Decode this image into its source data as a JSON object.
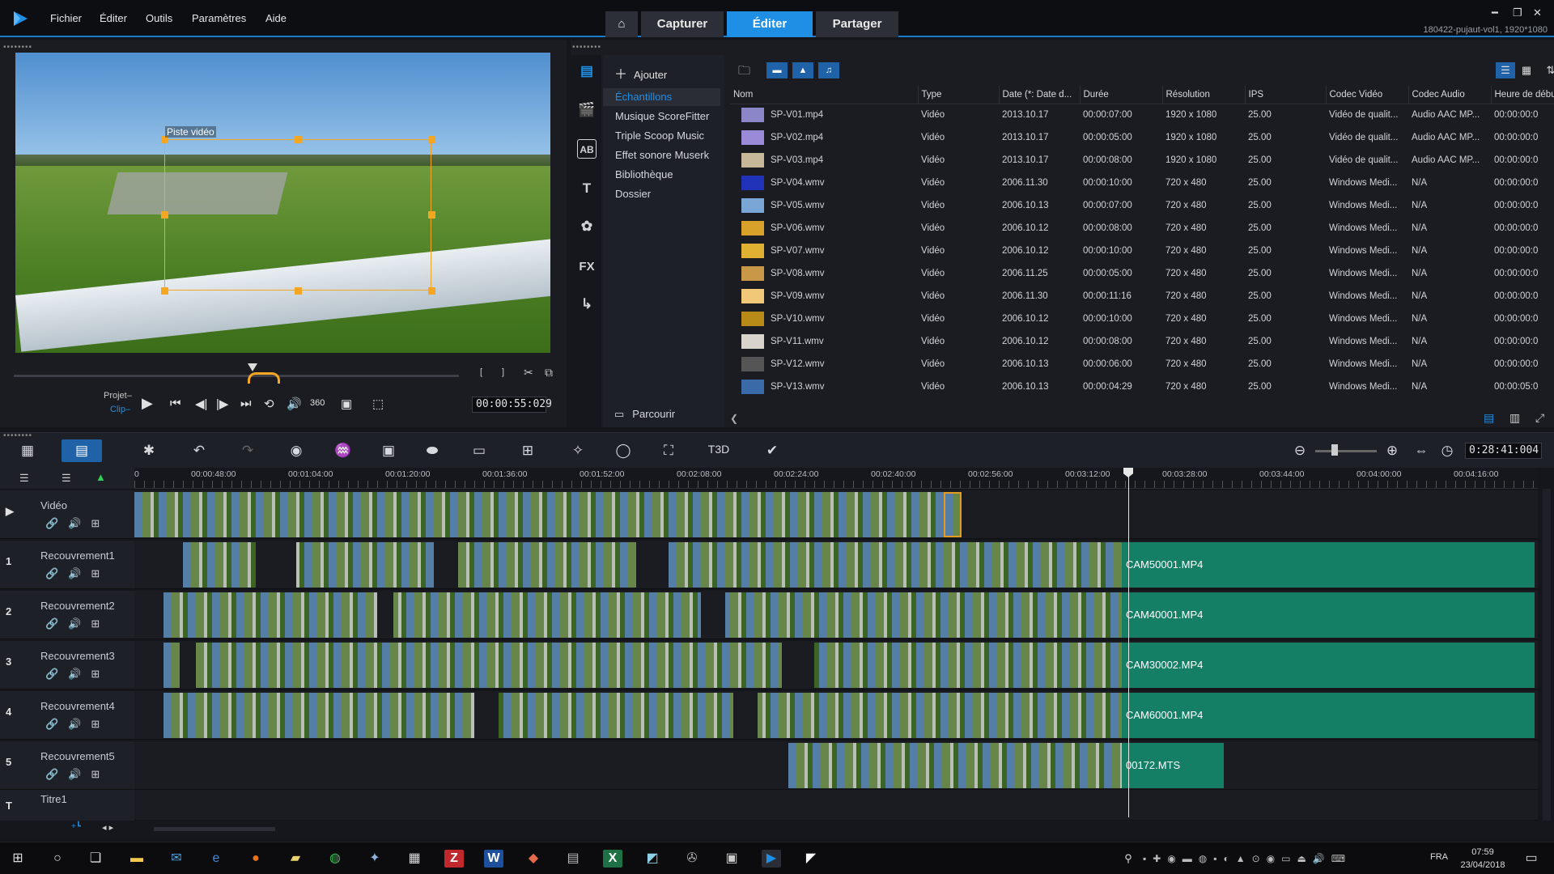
{
  "menubar": {
    "items": [
      "Fichier",
      "Éditer",
      "Outils",
      "Paramètres",
      "Aide"
    ],
    "tabs": {
      "capture": "Capturer",
      "edit": "Éditer",
      "share": "Partager"
    },
    "project_title": "180422-pujaut-vol1, 1920*1080"
  },
  "preview": {
    "overlay_label": "Piste vidéo",
    "project_label": "Projet–",
    "clip_label": "Clip–",
    "timecode": "00:00:55:029"
  },
  "library": {
    "add_label": "Ajouter",
    "nav_items": [
      "Échantillons",
      "Musique ScoreFitter",
      "Triple Scoop Music",
      "Effet sonore Muserk",
      "Bibliothèque",
      "Dossier"
    ],
    "browse_label": "Parcourir",
    "columns": [
      "Nom",
      "Type",
      "Date (*: Date d...",
      "Durée",
      "Résolution",
      "IPS",
      "Codec Vidéo",
      "Codec Audio",
      "Heure de début"
    ],
    "rows": [
      {
        "name": "SP-V01.mp4",
        "type": "Vidéo",
        "date": "2013.10.17",
        "duration": "00:00:07:00",
        "resolution": "1920 x 1080",
        "fps": "25.00",
        "vcodec": "Vidéo de qualit...",
        "acodec": "Audio AAC MP...",
        "start": "00:00:00:0",
        "color": "#8a86c8"
      },
      {
        "name": "SP-V02.mp4",
        "type": "Vidéo",
        "date": "2013.10.17",
        "duration": "00:00:05:00",
        "resolution": "1920 x 1080",
        "fps": "25.00",
        "vcodec": "Vidéo de qualit...",
        "acodec": "Audio AAC MP...",
        "start": "00:00:00:0",
        "color": "#9a8ad8"
      },
      {
        "name": "SP-V03.mp4",
        "type": "Vidéo",
        "date": "2013.10.17",
        "duration": "00:00:08:00",
        "resolution": "1920 x 1080",
        "fps": "25.00",
        "vcodec": "Vidéo de qualit...",
        "acodec": "Audio AAC MP...",
        "start": "00:00:00:0",
        "color": "#c8b89a"
      },
      {
        "name": "SP-V04.wmv",
        "type": "Vidéo",
        "date": "2006.11.30",
        "duration": "00:00:10:00",
        "resolution": "720 x 480",
        "fps": "25.00",
        "vcodec": "Windows Medi...",
        "acodec": "N/A",
        "start": "00:00:00:0",
        "color": "#2033b8"
      },
      {
        "name": "SP-V05.wmv",
        "type": "Vidéo",
        "date": "2006.10.13",
        "duration": "00:00:07:00",
        "resolution": "720 x 480",
        "fps": "25.00",
        "vcodec": "Windows Medi...",
        "acodec": "N/A",
        "start": "00:00:00:0",
        "color": "#7aa6d6"
      },
      {
        "name": "SP-V06.wmv",
        "type": "Vidéo",
        "date": "2006.10.12",
        "duration": "00:00:08:00",
        "resolution": "720 x 480",
        "fps": "25.00",
        "vcodec": "Windows Medi...",
        "acodec": "N/A",
        "start": "00:00:00:0",
        "color": "#d8a12a"
      },
      {
        "name": "SP-V07.wmv",
        "type": "Vidéo",
        "date": "2006.10.12",
        "duration": "00:00:10:00",
        "resolution": "720 x 480",
        "fps": "25.00",
        "vcodec": "Windows Medi...",
        "acodec": "N/A",
        "start": "00:00:00:0",
        "color": "#e0b032"
      },
      {
        "name": "SP-V08.wmv",
        "type": "Vidéo",
        "date": "2006.11.25",
        "duration": "00:00:05:00",
        "resolution": "720 x 480",
        "fps": "25.00",
        "vcodec": "Windows Medi...",
        "acodec": "N/A",
        "start": "00:00:00:0",
        "color": "#c89848"
      },
      {
        "name": "SP-V09.wmv",
        "type": "Vidéo",
        "date": "2006.11.30",
        "duration": "00:00:11:16",
        "resolution": "720 x 480",
        "fps": "25.00",
        "vcodec": "Windows Medi...",
        "acodec": "N/A",
        "start": "00:00:00:0",
        "color": "#f0c878"
      },
      {
        "name": "SP-V10.wmv",
        "type": "Vidéo",
        "date": "2006.10.12",
        "duration": "00:00:10:00",
        "resolution": "720 x 480",
        "fps": "25.00",
        "vcodec": "Windows Medi...",
        "acodec": "N/A",
        "start": "00:00:00:0",
        "color": "#b88a18"
      },
      {
        "name": "SP-V11.wmv",
        "type": "Vidéo",
        "date": "2006.10.12",
        "duration": "00:00:08:00",
        "resolution": "720 x 480",
        "fps": "25.00",
        "vcodec": "Windows Medi...",
        "acodec": "N/A",
        "start": "00:00:00:0",
        "color": "#d8d4cc"
      },
      {
        "name": "SP-V12.wmv",
        "type": "Vidéo",
        "date": "2006.10.13",
        "duration": "00:00:06:00",
        "resolution": "720 x 480",
        "fps": "25.00",
        "vcodec": "Windows Medi...",
        "acodec": "N/A",
        "start": "00:00:00:0",
        "color": "#555555"
      },
      {
        "name": "SP-V13.wmv",
        "type": "Vidéo",
        "date": "2006.10.13",
        "duration": "00:00:04:29",
        "resolution": "720 x 480",
        "fps": "25.00",
        "vcodec": "Windows Medi...",
        "acodec": "N/A",
        "start": "00:00:05:0",
        "color": "#3b6aa8"
      }
    ]
  },
  "timeline": {
    "timecode": "0:28:41:004",
    "ruler_labels": [
      "0",
      "00:00:48:00",
      "00:01:04:00",
      "00:01:20:00",
      "00:01:36:00",
      "00:01:52:00",
      "00:02:08:00",
      "00:02:24:00",
      "00:02:40:00",
      "00:02:56:00",
      "00:03:12:00",
      "00:03:28:00",
      "00:03:44:00",
      "00:04:00:00",
      "00:04:16:00"
    ],
    "tracks": [
      {
        "num": "",
        "name": "Vidéo",
        "end_clip": ""
      },
      {
        "num": "1",
        "name": "Recouvrement1",
        "end_clip": "CAM50001.MP4"
      },
      {
        "num": "2",
        "name": "Recouvrement2",
        "end_clip": "CAM40001.MP4"
      },
      {
        "num": "3",
        "name": "Recouvrement3",
        "end_clip": "CAM30002.MP4"
      },
      {
        "num": "4",
        "name": "Recouvrement4",
        "end_clip": "CAM60001.MP4"
      },
      {
        "num": "5",
        "name": "Recouvrement5",
        "end_clip": "00172.MTS"
      }
    ],
    "title_track": "Titre1"
  },
  "taskbar": {
    "lang": "FRA",
    "time": "07:59",
    "date": "23/04/2018"
  },
  "colors": {
    "accent": "#1f8fe6",
    "clip_end": "#157f66",
    "selection": "#f5a623"
  }
}
